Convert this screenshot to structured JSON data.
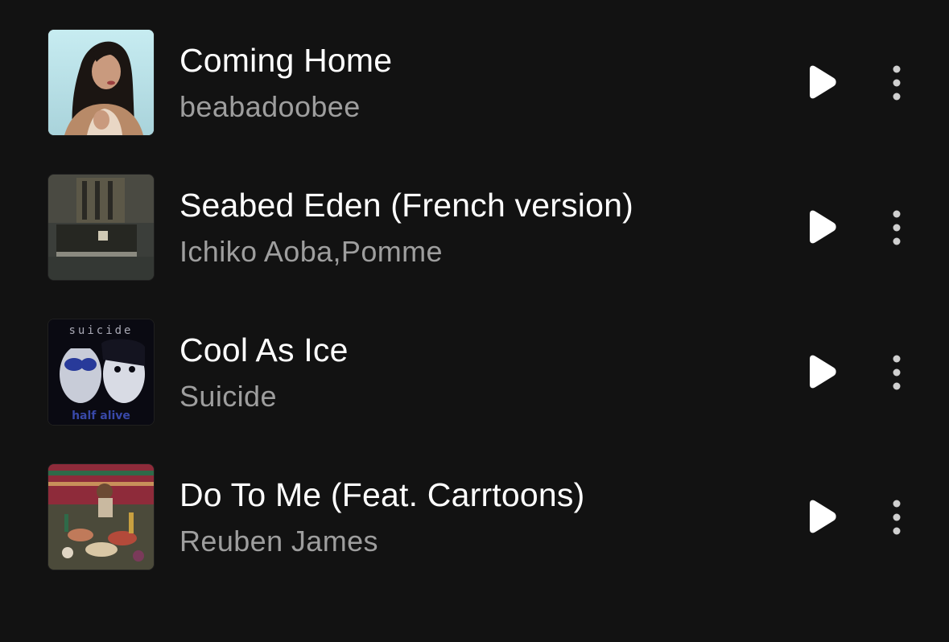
{
  "tracks": [
    {
      "title": "Coming Home",
      "artist": "beabadoobee",
      "cover_icon": "album-cover-portrait",
      "cover_colors": [
        "#bfe6ec",
        "#1a1412",
        "#c9a183",
        "#7a5a46"
      ]
    },
    {
      "title": "Seabed Eden (French version)",
      "artist": "Ichiko Aoba,Pomme",
      "cover_icon": "album-cover-piano-room",
      "cover_colors": [
        "#3c3f3b",
        "#5a5446",
        "#23241f"
      ]
    },
    {
      "title": "Cool As Ice",
      "artist": "Suicide",
      "cover_icon": "album-cover-suicide-half-alive",
      "cover_text_top": "suicide",
      "cover_text_bottom": "half alive",
      "cover_colors": [
        "#0a0a12",
        "#9aa6d8",
        "#3848a8"
      ]
    },
    {
      "title": "Do To Me (Feat. Carrtoons)",
      "artist": "Reuben James",
      "cover_icon": "album-cover-feast-table",
      "cover_colors": [
        "#8e2b3a",
        "#2f6a49",
        "#c8905a"
      ]
    }
  ],
  "actions": {
    "play_icon": "play-icon",
    "more_icon": "more-vertical-icon"
  },
  "colors": {
    "background": "#121212",
    "title": "#ffffff",
    "artist": "#9e9e9e"
  }
}
